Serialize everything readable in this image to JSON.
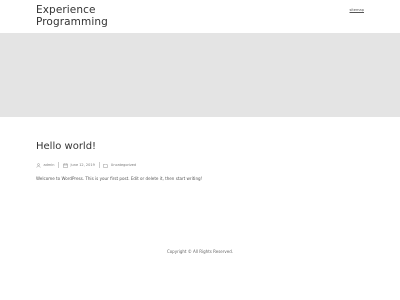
{
  "header": {
    "site_title": "Experience\nProgramming",
    "nav_link": "sitemap"
  },
  "post": {
    "title": "Hello world!",
    "meta": {
      "author": "admin",
      "date": "June 12, 2019",
      "category": "Uncategorized"
    },
    "content": "Welcome to WordPress. This is your first post. Edit or delete it, then start writing!"
  },
  "footer": {
    "copyright": "Copyright © All Rights Reserved."
  },
  "icons": {
    "author": "user-icon",
    "date": "calendar-icon",
    "category": "folder-icon"
  }
}
